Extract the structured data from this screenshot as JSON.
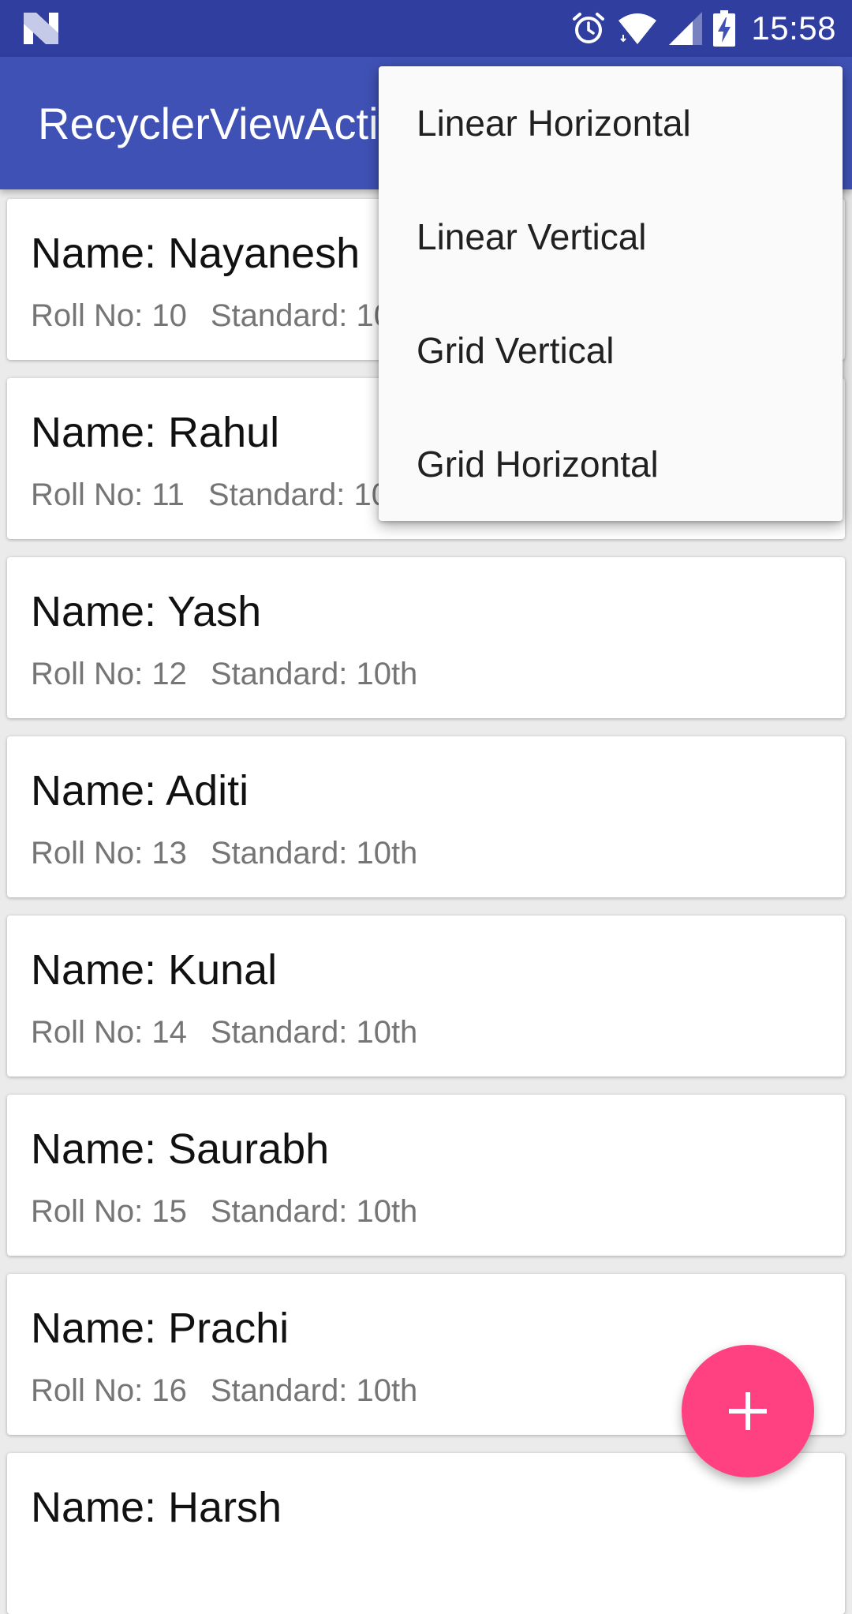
{
  "status_bar": {
    "time": "15:58",
    "icons": [
      "n-logo-icon",
      "alarm-icon",
      "wifi-icon",
      "signal-icon",
      "battery-charging-icon"
    ]
  },
  "app_bar": {
    "title": "RecyclerViewActivity"
  },
  "students": [
    {
      "name": "Name: Nayanesh",
      "roll": "Roll No: 10",
      "standard": "Standard: 10th"
    },
    {
      "name": "Name: Rahul",
      "roll": "Roll No: 11",
      "standard": "Standard: 10th"
    },
    {
      "name": "Name: Yash",
      "roll": "Roll No: 12",
      "standard": "Standard: 10th"
    },
    {
      "name": "Name: Aditi",
      "roll": "Roll No: 13",
      "standard": "Standard: 10th"
    },
    {
      "name": "Name: Kunal",
      "roll": "Roll No: 14",
      "standard": "Standard: 10th"
    },
    {
      "name": "Name: Saurabh",
      "roll": "Roll No: 15",
      "standard": "Standard: 10th"
    },
    {
      "name": "Name: Prachi",
      "roll": "Roll No: 16",
      "standard": "Standard: 10th"
    },
    {
      "name": "Name: Harsh",
      "roll": "",
      "standard": ""
    }
  ],
  "menu": {
    "items": [
      "Linear Horizontal",
      "Linear Vertical",
      "Grid Vertical",
      "Grid Horizontal"
    ]
  },
  "fab": {
    "icon": "plus-icon"
  },
  "colors": {
    "status_bar": "#303f9f",
    "app_bar": "#3f51b5",
    "fab": "#ff4081",
    "background": "#ebebeb"
  }
}
